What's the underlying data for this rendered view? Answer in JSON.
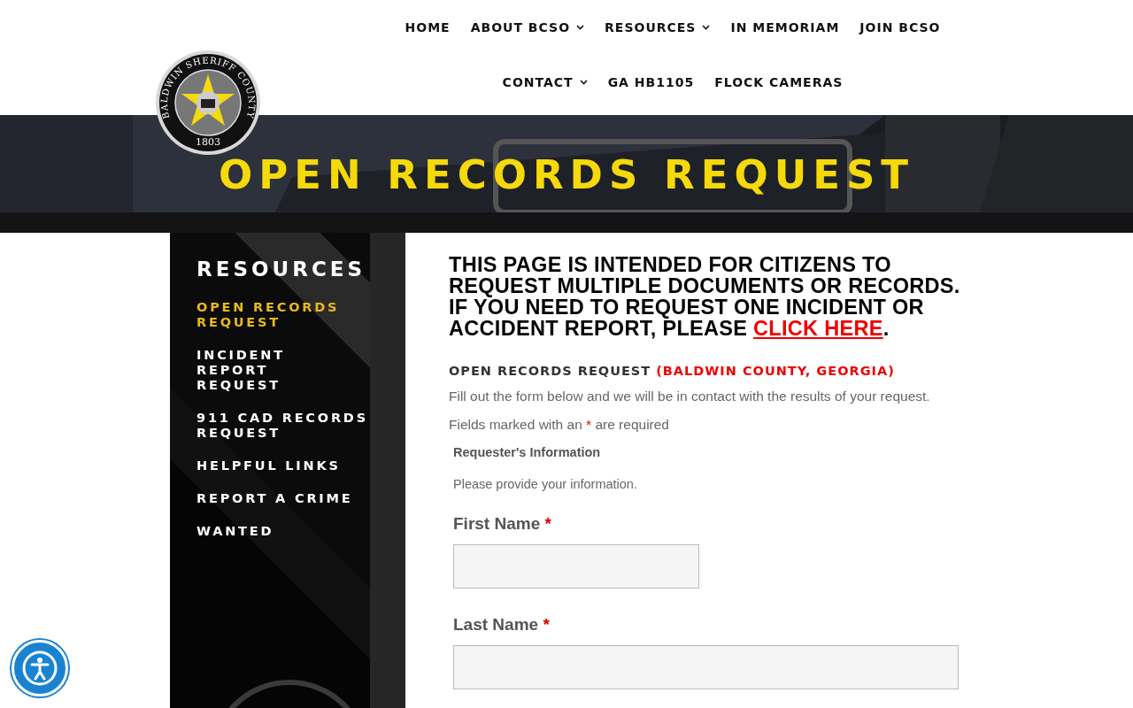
{
  "logo": {
    "ring_text": "BALDWIN SHERIFF COUNTY",
    "year": "1803"
  },
  "nav": [
    {
      "label": "HOME",
      "has_menu": false
    },
    {
      "label": "ABOUT BCSO",
      "has_menu": true
    },
    {
      "label": "RESOURCES",
      "has_menu": true
    },
    {
      "label": "IN MEMORIAM",
      "has_menu": false
    },
    {
      "label": "JOIN BCSO",
      "has_menu": false
    },
    {
      "label": "CONTACT",
      "has_menu": true
    },
    {
      "label": "GA HB1105",
      "has_menu": false
    },
    {
      "label": "FLOCK CAMERAS",
      "has_menu": false
    }
  ],
  "banner": {
    "kind": "picture",
    "title": "OPEN RECORDS REQUEST"
  },
  "sidebar": {
    "title": "RESOURCES",
    "items": [
      {
        "label": "OPEN RECORDS REQUEST",
        "selected": true
      },
      {
        "label": "INCIDENT REPORT REQUEST",
        "selected": false
      },
      {
        "label": "911 CAD RECORDS REQUEST",
        "selected": false
      },
      {
        "label": "HELPFUL LINKS",
        "selected": false
      },
      {
        "label": "REPORT A CRIME",
        "selected": false
      },
      {
        "label": "WANTED",
        "selected": false
      }
    ]
  },
  "notice": {
    "text": "THIS PAGE IS INTENDED FOR CITIZENS TO REQUEST MULTIPLE DOCUMENTS OR RECORDS.  IF YOU NEED TO REQUEST ONE INCIDENT OR ACCIDENT REPORT, PLEASE",
    "link": "CLICK HERE",
    "end": "."
  },
  "form": {
    "title": "OPEN RECORDS REQUEST",
    "county": "(BALDWIN COUNTY, GEORGIA)",
    "intro": "Fill out the form below and we will be in contact with the results of your request.",
    "required_note": {
      "before": "Fields marked with an",
      "mark": "*",
      "after": "are required"
    },
    "section": "Requester's Information",
    "section_note": "Please provide your information.",
    "fields": [
      {
        "label": "First Name",
        "required": true,
        "kind": "short"
      },
      {
        "label": "Last Name",
        "required": true,
        "kind": "full"
      }
    ]
  }
}
